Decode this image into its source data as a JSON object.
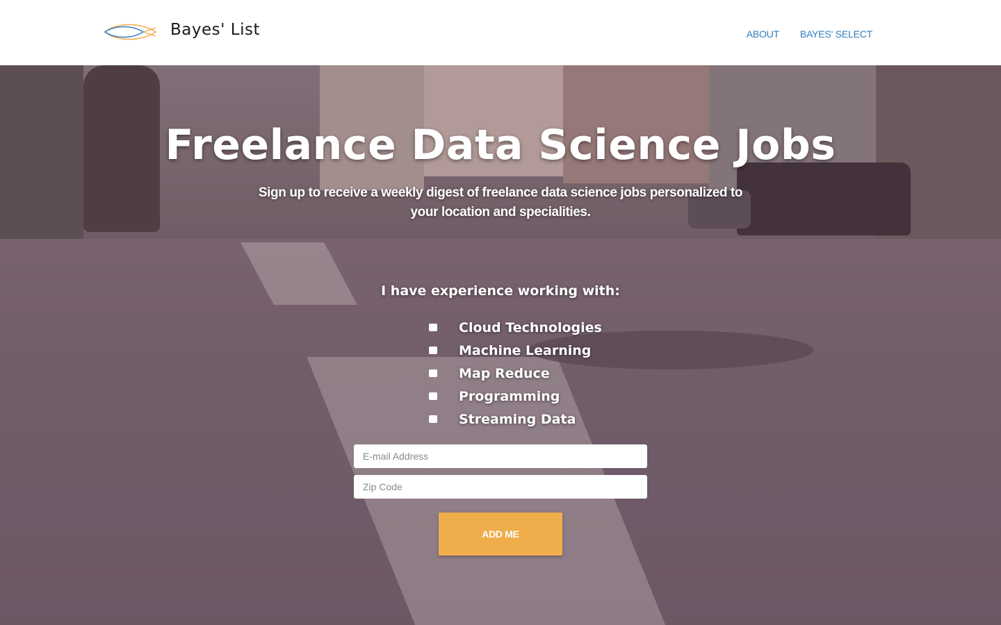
{
  "header": {
    "brand": "Bayes' List",
    "logo_icon": "eye-fish-logo",
    "nav": [
      {
        "label": "ABOUT"
      },
      {
        "label": "BAYES' SELECT"
      }
    ]
  },
  "hero": {
    "title": "Freelance Data Science Jobs",
    "subtitle": "Sign up to receive a weekly digest of freelance data science jobs personalized to your location and specialities.",
    "experience_label": "I have experience working with:",
    "options": [
      {
        "label": "Cloud Technologies",
        "checked": false
      },
      {
        "label": "Machine Learning",
        "checked": false
      },
      {
        "label": "Map Reduce",
        "checked": false
      },
      {
        "label": "Programming",
        "checked": false
      },
      {
        "label": "Streaming Data",
        "checked": false
      }
    ],
    "email": {
      "placeholder": "E-mail Address",
      "value": ""
    },
    "zip": {
      "placeholder": "Zip Code",
      "value": ""
    },
    "submit_label": "ADD ME"
  },
  "colors": {
    "nav_link": "#2f7fc1",
    "button": "#efad4b",
    "logo_blue": "#3a7fc2",
    "logo_orange": "#efad4b"
  }
}
